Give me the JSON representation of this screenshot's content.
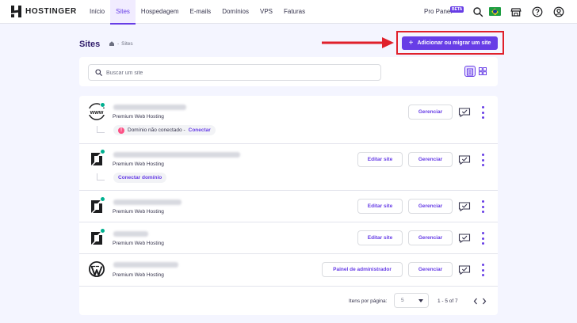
{
  "brand": {
    "name": "HOSTINGER"
  },
  "nav": {
    "items": [
      "Início",
      "Sites",
      "Hospedagem",
      "E-mails",
      "Domínios",
      "VPS",
      "Faturas"
    ],
    "active_index": 1,
    "pro_panel": "Pro Panel",
    "beta_badge": "BETA"
  },
  "header": {
    "title": "Sites",
    "breadcrumb_sep": "-",
    "breadcrumb": "Sites",
    "add_button": "Adicionar ou migrar um site"
  },
  "search": {
    "placeholder": "Buscar um site",
    "value": ""
  },
  "sites": [
    {
      "plan": "Premium Web Hosting",
      "icon": "www-icon",
      "warning": "Domínio não conectado -",
      "warning_action": "Conectar",
      "manage": "Gerenciar"
    },
    {
      "plan": "Premium Web Hosting",
      "icon": "builder-icon",
      "chip": "Conectar domínio",
      "edit": "Editar site",
      "manage": "Gerenciar"
    },
    {
      "plan": "Premium Web Hosting",
      "icon": "builder-icon",
      "edit": "Editar site",
      "manage": "Gerenciar"
    },
    {
      "plan": "Premium Web Hosting",
      "icon": "builder-icon",
      "edit": "Editar site",
      "manage": "Gerenciar"
    },
    {
      "plan": "Premium Web Hosting",
      "icon": "wordpress-icon",
      "admin": "Painel de administrador",
      "manage": "Gerenciar"
    }
  ],
  "pagination": {
    "label": "Itens por página:",
    "per_page": "5",
    "range": "1 - 5 of 7"
  },
  "colors": {
    "primary": "#673de6",
    "highlight": "#e0202b",
    "status_ok": "#00b090",
    "warning": "#fc5185"
  }
}
